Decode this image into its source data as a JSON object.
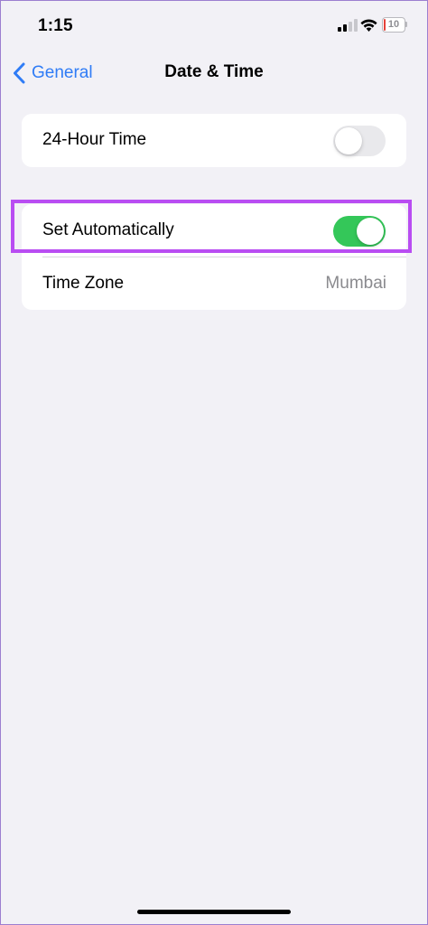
{
  "status_bar": {
    "time": "1:15",
    "battery_level": "10",
    "battery_fraction": 0.1,
    "icons": [
      "signal-icon",
      "wifi-icon",
      "battery-icon"
    ]
  },
  "nav": {
    "back_label": "General",
    "title": "Date & Time"
  },
  "settings": {
    "time_format": {
      "label": "24-Hour Time",
      "enabled": false
    },
    "set_automatically": {
      "label": "Set Automatically",
      "enabled": true
    },
    "time_zone": {
      "label": "Time Zone",
      "value": "Mumbai"
    }
  },
  "colors": {
    "accent": "#2f7cf6",
    "toggle_on": "#34c759",
    "toggle_off": "#e9e9ec",
    "highlight": "#b94df2",
    "battery_low": "#e5413a",
    "background": "#f2f1f6"
  }
}
